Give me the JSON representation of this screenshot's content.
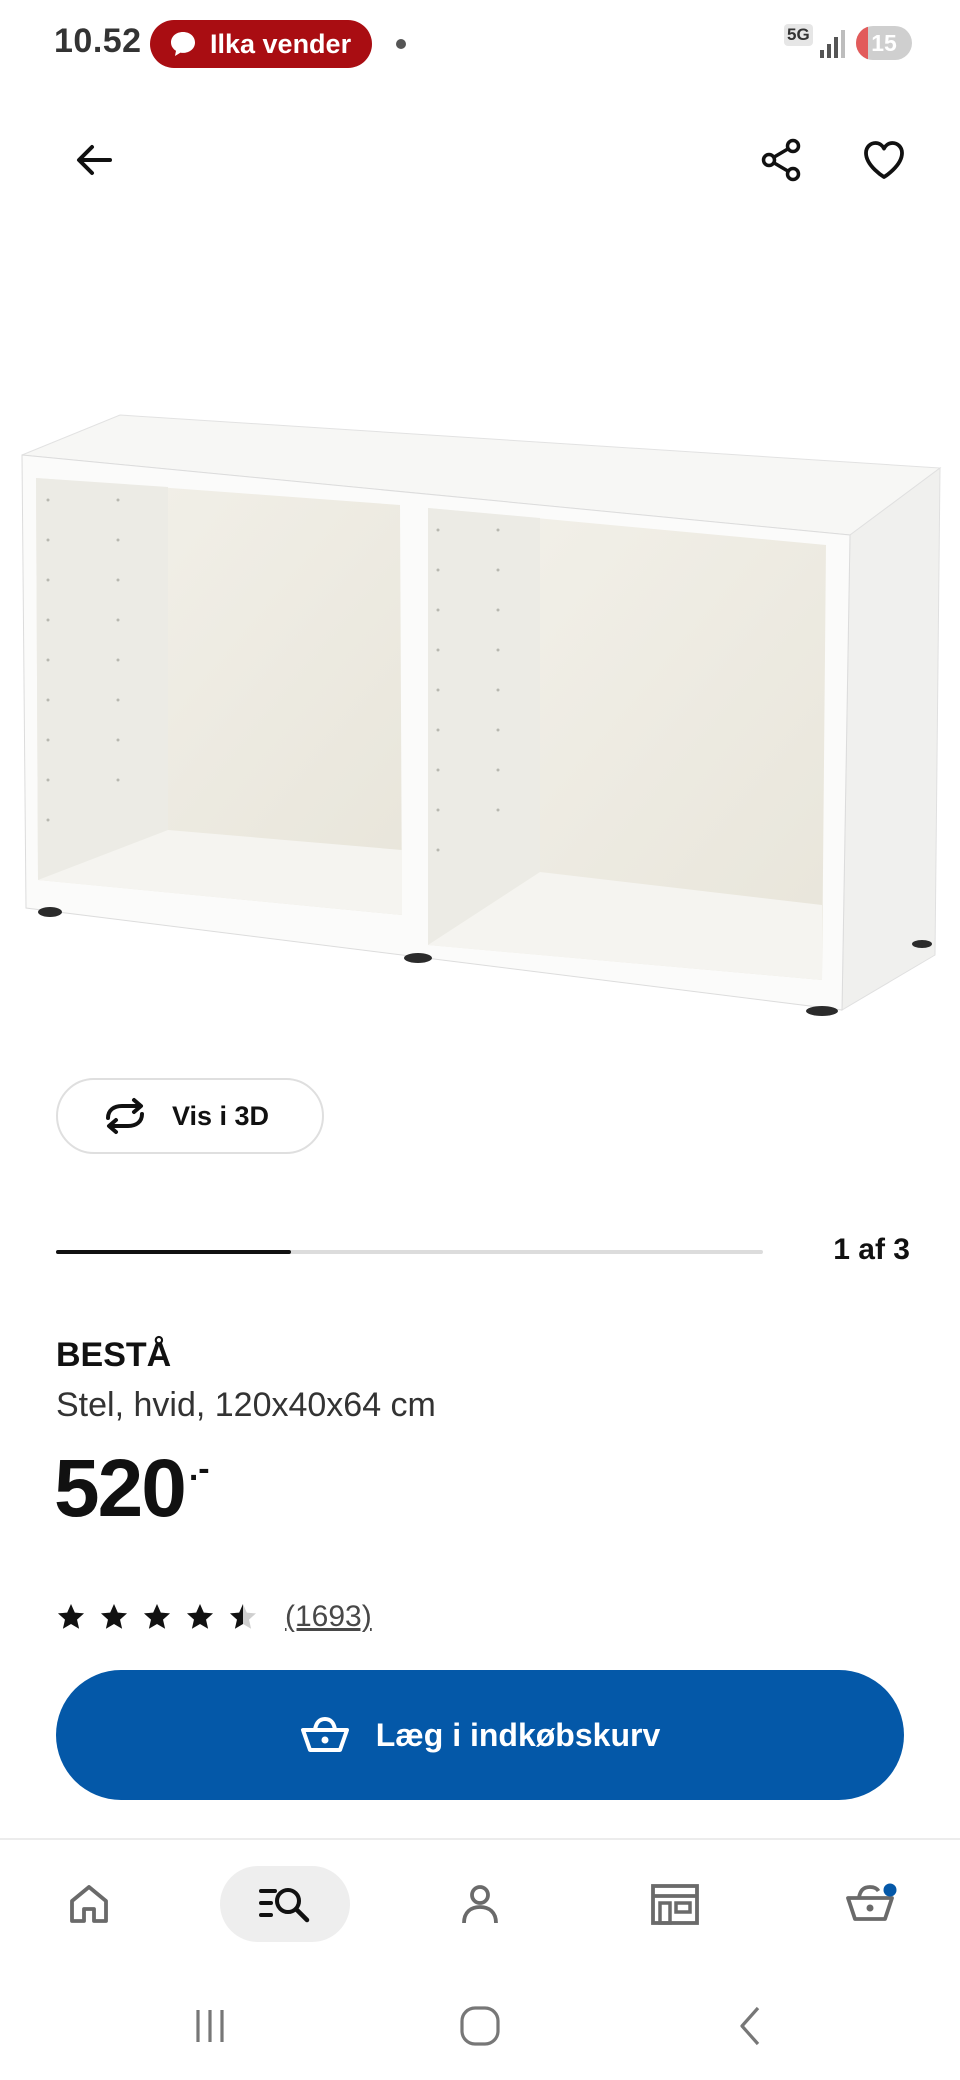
{
  "status_bar": {
    "time": "10.52",
    "call_label": "Ilka vender",
    "network": "5G",
    "battery": "15"
  },
  "icons": {
    "back": "arrow-left",
    "share": "share",
    "favourite": "heart",
    "rotate": "rotate-3d",
    "cart": "shopping-basket",
    "nav": [
      "home",
      "search-list",
      "person",
      "store",
      "cart"
    ],
    "system": [
      "recents",
      "home",
      "back"
    ]
  },
  "product": {
    "name": "BESTÅ",
    "description": "Stel, hvid, 120x40x64 cm",
    "price": "520",
    "price_suffix": ".-",
    "rating": 4.5,
    "reviews": "(1693)"
  },
  "gallery": {
    "view_3d_label": "Vis i 3D",
    "position": "1 af 3",
    "progress": 0.333
  },
  "actions": {
    "add_to_cart_label": "Læg i indkøbskurv"
  },
  "colors": {
    "primary": "#0458a8",
    "call_pill": "#a90d12",
    "cart_badge": "#0458a8"
  },
  "bottom_nav": {
    "active": "search",
    "cart_badge": true
  }
}
